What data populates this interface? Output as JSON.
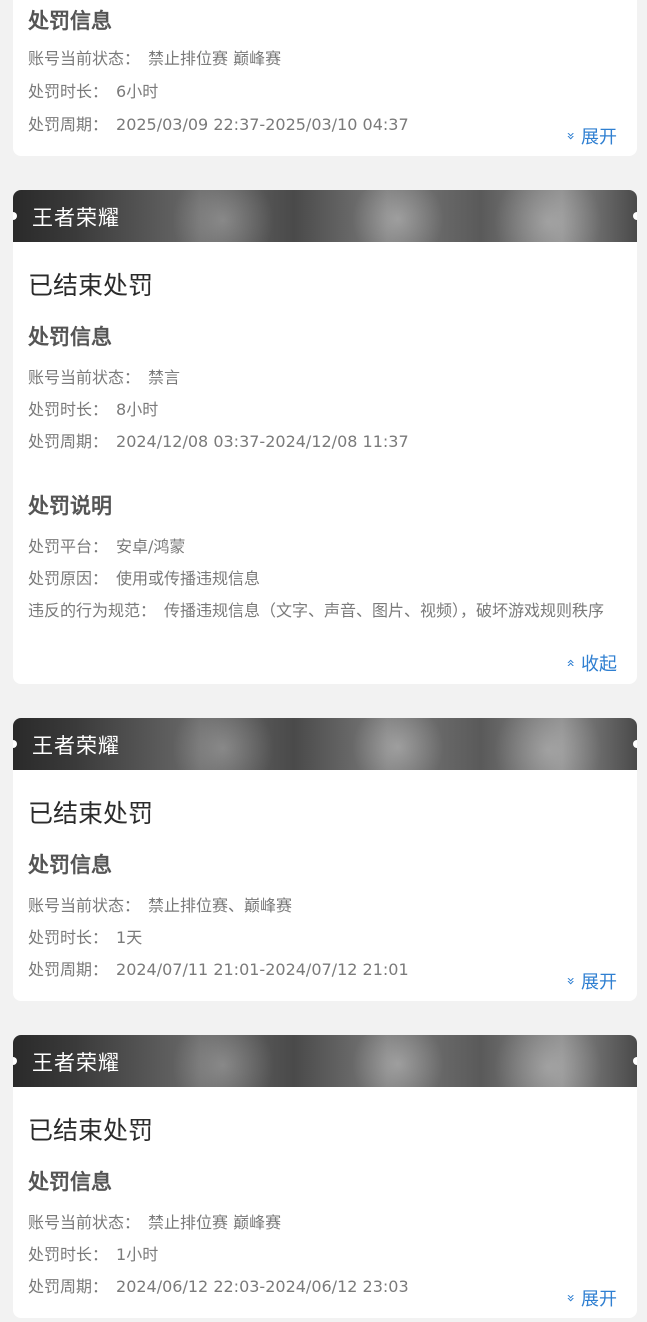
{
  "top_card": {
    "section_title": "处罚信息",
    "rows": [
      {
        "label": "账号当前状态：",
        "value": "禁止排位赛 巅峰赛"
      },
      {
        "label": "处罚时长：",
        "value": "6小时"
      },
      {
        "label": "处罚周期：",
        "value": "2025/03/09 22:37-2025/03/10 04:37"
      }
    ],
    "toggle_label": "展开",
    "toggle_icon": "»"
  },
  "cards": [
    {
      "game": "王者荣耀",
      "status": "已结束处罚",
      "info_title": "处罚信息",
      "info_rows": [
        {
          "label": "账号当前状态：",
          "value": "禁言"
        },
        {
          "label": "处罚时长：",
          "value": "8小时"
        },
        {
          "label": "处罚周期：",
          "value": "2024/12/08 03:37-2024/12/08 11:37"
        }
      ],
      "desc_title": "处罚说明",
      "desc_rows": [
        {
          "label": "处罚平台：",
          "value": "安卓/鸿蒙"
        },
        {
          "label": "处罚原因：",
          "value": "使用或传播违规信息"
        },
        {
          "label": "违反的行为规范：",
          "value": "传播违规信息（文字、声音、图片、视频），破坏游戏规则秩序"
        }
      ],
      "toggle_label": "收起",
      "toggle_icon": "«"
    },
    {
      "game": "王者荣耀",
      "status": "已结束处罚",
      "info_title": "处罚信息",
      "info_rows": [
        {
          "label": "账号当前状态：",
          "value": "禁止排位赛、巅峰赛"
        },
        {
          "label": "处罚时长：",
          "value": "1天"
        },
        {
          "label": "处罚周期：",
          "value": "2024/07/11 21:01-2024/07/12 21:01"
        }
      ],
      "toggle_label": "展开",
      "toggle_icon": "»"
    },
    {
      "game": "王者荣耀",
      "status": "已结束处罚",
      "info_title": "处罚信息",
      "info_rows": [
        {
          "label": "账号当前状态：",
          "value": "禁止排位赛 巅峰赛"
        },
        {
          "label": "处罚时长：",
          "value": "1小时"
        },
        {
          "label": "处罚周期：",
          "value": "2024/06/12 22:03-2024/06/12 23:03"
        }
      ],
      "toggle_label": "展开",
      "toggle_icon": "»"
    }
  ],
  "colors": {
    "accent": "#2f7fd1",
    "background": "#f2f2f2",
    "card": "#ffffff",
    "banner_dark": "#2a2a2a"
  }
}
